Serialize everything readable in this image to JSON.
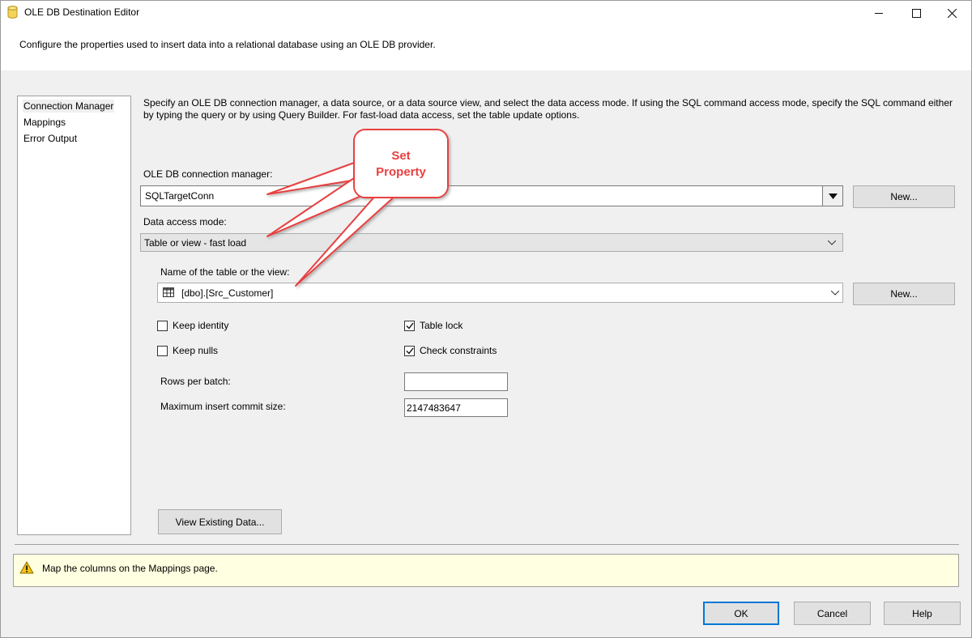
{
  "window": {
    "title": "OLE DB Destination Editor",
    "description": "Configure the properties used to insert data into a relational database using an OLE DB provider."
  },
  "nav": {
    "items": [
      "Connection Manager",
      "Mappings",
      "Error Output"
    ]
  },
  "main": {
    "instructions": "Specify an OLE DB connection manager, a data source, or a data source view, and select the data access mode. If using the SQL command access mode, specify the SQL command either by typing the query or by using Query Builder. For fast-load data access, set the table update options.",
    "connection_label": "OLE DB connection manager:",
    "connection_value": "SQLTargetConn",
    "new_label": "New...",
    "access_mode_label": "Data access mode:",
    "access_mode_value": "Table or view - fast load",
    "table_label": "Name of the table or the view:",
    "table_value": "[dbo].[Src_Customer]",
    "keep_identity": "Keep identity",
    "keep_nulls": "Keep nulls",
    "table_lock": "Table lock",
    "check_constraints": "Check constraints",
    "rows_per_batch_label": "Rows per batch:",
    "rows_per_batch_value": "",
    "max_commit_label": "Maximum insert commit size:",
    "max_commit_value": "2147483647",
    "view_existing": "View Existing Data..."
  },
  "callout": {
    "line1": "Set",
    "line2": "Property"
  },
  "status": {
    "warning": "Map the columns on the Mappings page."
  },
  "footer": {
    "ok": "OK",
    "cancel": "Cancel",
    "help": "Help"
  },
  "colors": {
    "callout_red": "#e84040",
    "warning_bg": "#ffffe1",
    "focus_blue": "#0078d7"
  }
}
